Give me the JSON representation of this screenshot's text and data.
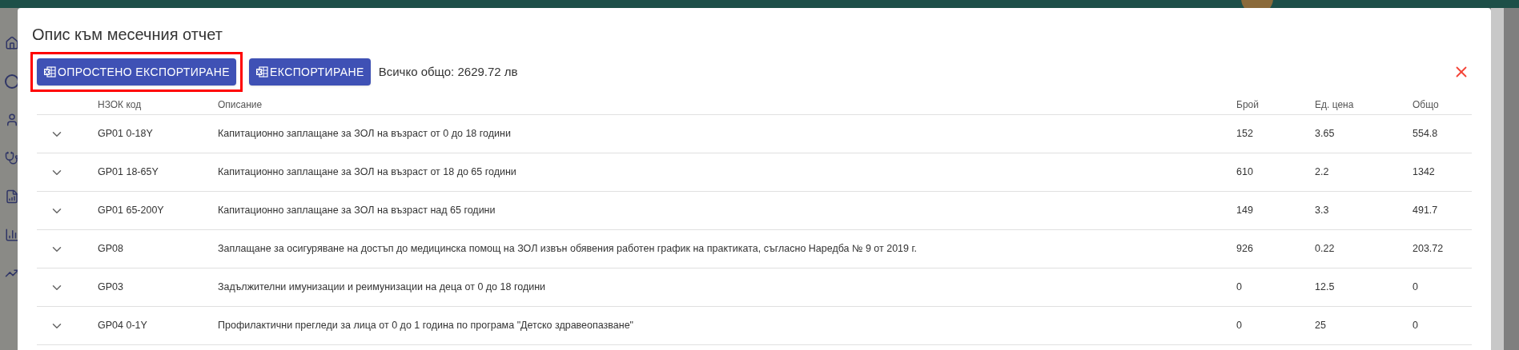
{
  "dialog": {
    "title": "Опис към месечния отчет",
    "buttons": [
      {
        "label": "ОПРОСТЕНО ЕКСПОРТИРАНЕ",
        "highlighted": true
      },
      {
        "label": "ЕКСПОРТИРАНЕ",
        "highlighted": false
      }
    ],
    "total": "Всичко общо: 2629.72 лв",
    "table": {
      "columns": [
        "НЗОК код",
        "Описание",
        "Брой",
        "Ед. цена",
        "Общо"
      ],
      "rows": [
        {
          "code": "GP01 0-18Y",
          "description": "Капитационно заплащане за ЗОЛ на възраст от 0 до 18 години",
          "count": "152",
          "unit_price": "3.65",
          "total": "554.8"
        },
        {
          "code": "GP01 18-65Y",
          "description": "Капитационно заплащане за ЗОЛ на възраст от 18 до 65 години",
          "count": "610",
          "unit_price": "2.2",
          "total": "1342"
        },
        {
          "code": "GP01 65-200Y",
          "description": "Капитационно заплащане за ЗОЛ на възраст над 65 години",
          "count": "149",
          "unit_price": "3.3",
          "total": "491.7"
        },
        {
          "code": "GP08",
          "description": "Заплащане за осигуряване на достъп до медицинска помощ на ЗОЛ извън обявения работен график на практиката, съгласно Наредба № 9 от 2019 г.",
          "count": "926",
          "unit_price": "0.22",
          "total": "203.72"
        },
        {
          "code": "GP03",
          "description": "Задължителни имунизации и реимунизации на деца от 0 до 18 години",
          "count": "0",
          "unit_price": "12.5",
          "total": "0"
        },
        {
          "code": "GP04 0-1Y",
          "description": "Профилактични прегледи за лица от 0 до 1 година по програма \"Детско здравеопазване\"",
          "count": "0",
          "unit_price": "25",
          "total": "0"
        }
      ]
    }
  }
}
